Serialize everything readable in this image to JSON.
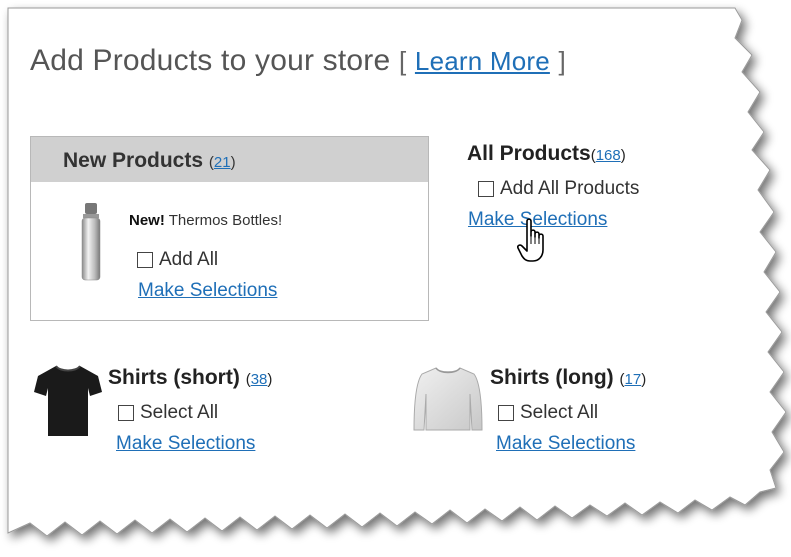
{
  "header": {
    "title": "Add Products to your store",
    "bracket_open": "[",
    "learn_more": "Learn More",
    "bracket_close": "]"
  },
  "new_products": {
    "title": "New Products",
    "count": "21",
    "item_badge": "New!",
    "item_text": "Thermos Bottles!",
    "checkbox_label": "Add All",
    "make_selections": "Make Selections"
  },
  "all_products": {
    "title": "All Products",
    "count": "168",
    "checkbox_label": "Add All Products",
    "make_selections": "Make Selections"
  },
  "shirts_short": {
    "title": "Shirts (short)",
    "count": "38",
    "checkbox_label": "Select All",
    "make_selections": "Make Selections"
  },
  "shirts_long": {
    "title": "Shirts (long)",
    "count": "17",
    "checkbox_label": "Select All",
    "make_selections": "Make Selections"
  },
  "icons": {
    "thermos": "thermos-bottle-icon",
    "short_shirt": "tshirt-icon",
    "long_shirt": "sweatshirt-icon",
    "cursor": "hand-pointer-icon"
  },
  "colors": {
    "link": "#1f6fb7",
    "header_bar": "#d0d0d0",
    "panel_border": "#b8b8b8"
  }
}
